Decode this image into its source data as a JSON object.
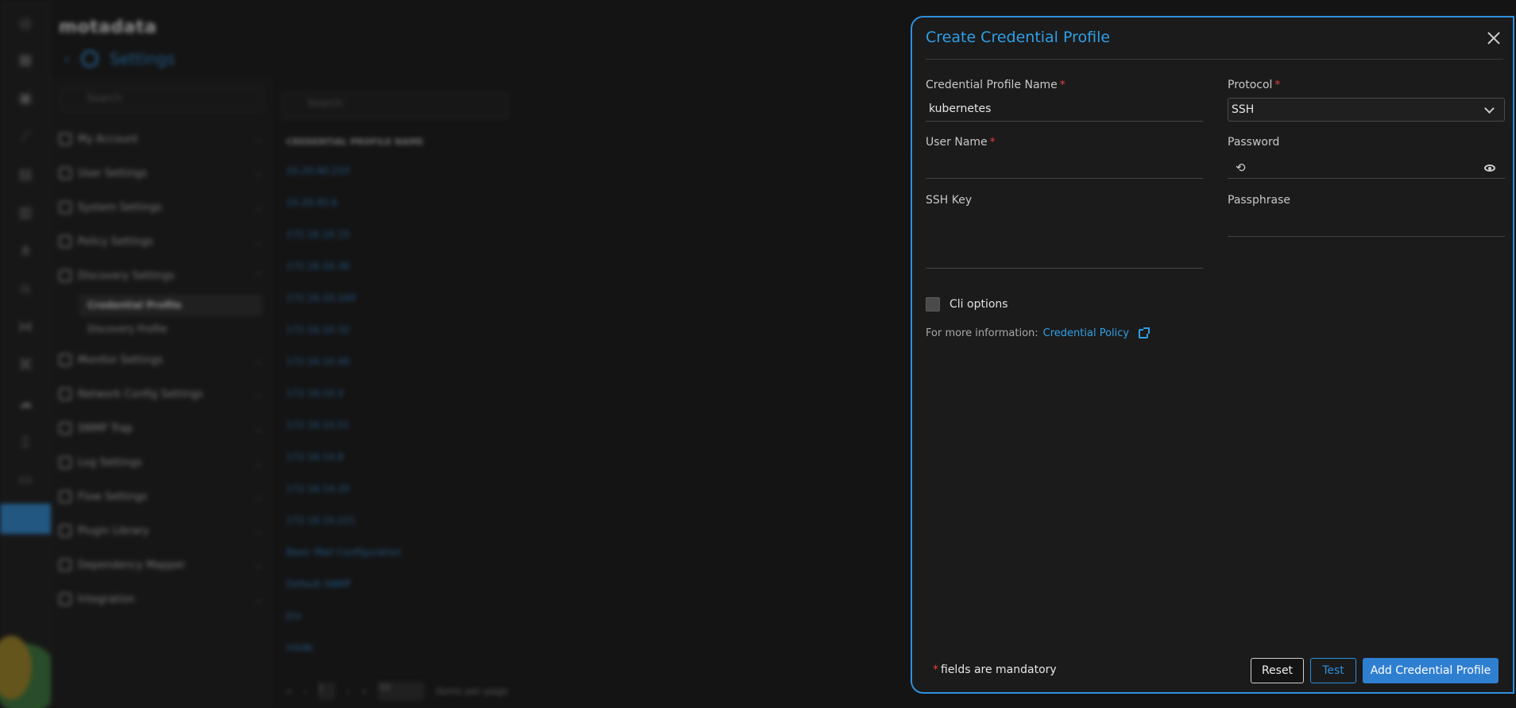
{
  "drawer": {
    "title": "Create Credential Profile",
    "fields": {
      "profile_name": {
        "label": "Credential Profile Name",
        "value": "kubernetes",
        "required": "*"
      },
      "protocol": {
        "label": "Protocol",
        "value": "SSH",
        "required": "*"
      },
      "user_name": {
        "label": "User Name",
        "value": "",
        "required": "*"
      },
      "password": {
        "label": "Password",
        "value": ""
      },
      "ssh_key": {
        "label": "SSH Key",
        "value": ""
      },
      "passphrase": {
        "label": "Passphrase",
        "value": ""
      }
    },
    "cli_options_label": "Cli options",
    "info_text": "For more information:",
    "info_link": "Credential Policy",
    "footer": {
      "mandatory_star": "*",
      "mandatory_text": "fields are mandatory",
      "reset": "Reset",
      "test": "Test",
      "add": "Add Credential Profile"
    }
  },
  "background": {
    "logo": "motadata",
    "breadcrumb": "Settings",
    "nav_search_placeholder": "Search",
    "list_search_placeholder": "Search",
    "nav_items": [
      "My Account",
      "User Settings",
      "System Settings",
      "Policy Settings",
      "Discovery Settings"
    ],
    "nav_subitems": [
      "Credential Profile",
      "Discovery Profile"
    ],
    "nav_items_after": [
      "Monitor Settings",
      "Network Config Settings",
      "SNMP Trap",
      "Log Settings",
      "Flow Settings",
      "Plugin Library",
      "Dependency Mapper",
      "Integration"
    ],
    "column_header": "CREDENTIAL PROFILE NAME",
    "rows": [
      "10.20.40.233",
      "10.20.45.6",
      "172.16.10.15",
      "172.16.10.36",
      "172.16.10.160",
      "172.16.10.32",
      "172.16.10.40",
      "172.16.10.3",
      "172.16.10.51",
      "172.16.14.8",
      "172.16.14.20",
      "172.16.10.221",
      "Basic Mail Configuration",
      "Default SNMP",
      "Jira",
      "mkdb"
    ],
    "pager": {
      "page": "1",
      "per_page": "50",
      "per_page_label": "Items per page"
    }
  }
}
